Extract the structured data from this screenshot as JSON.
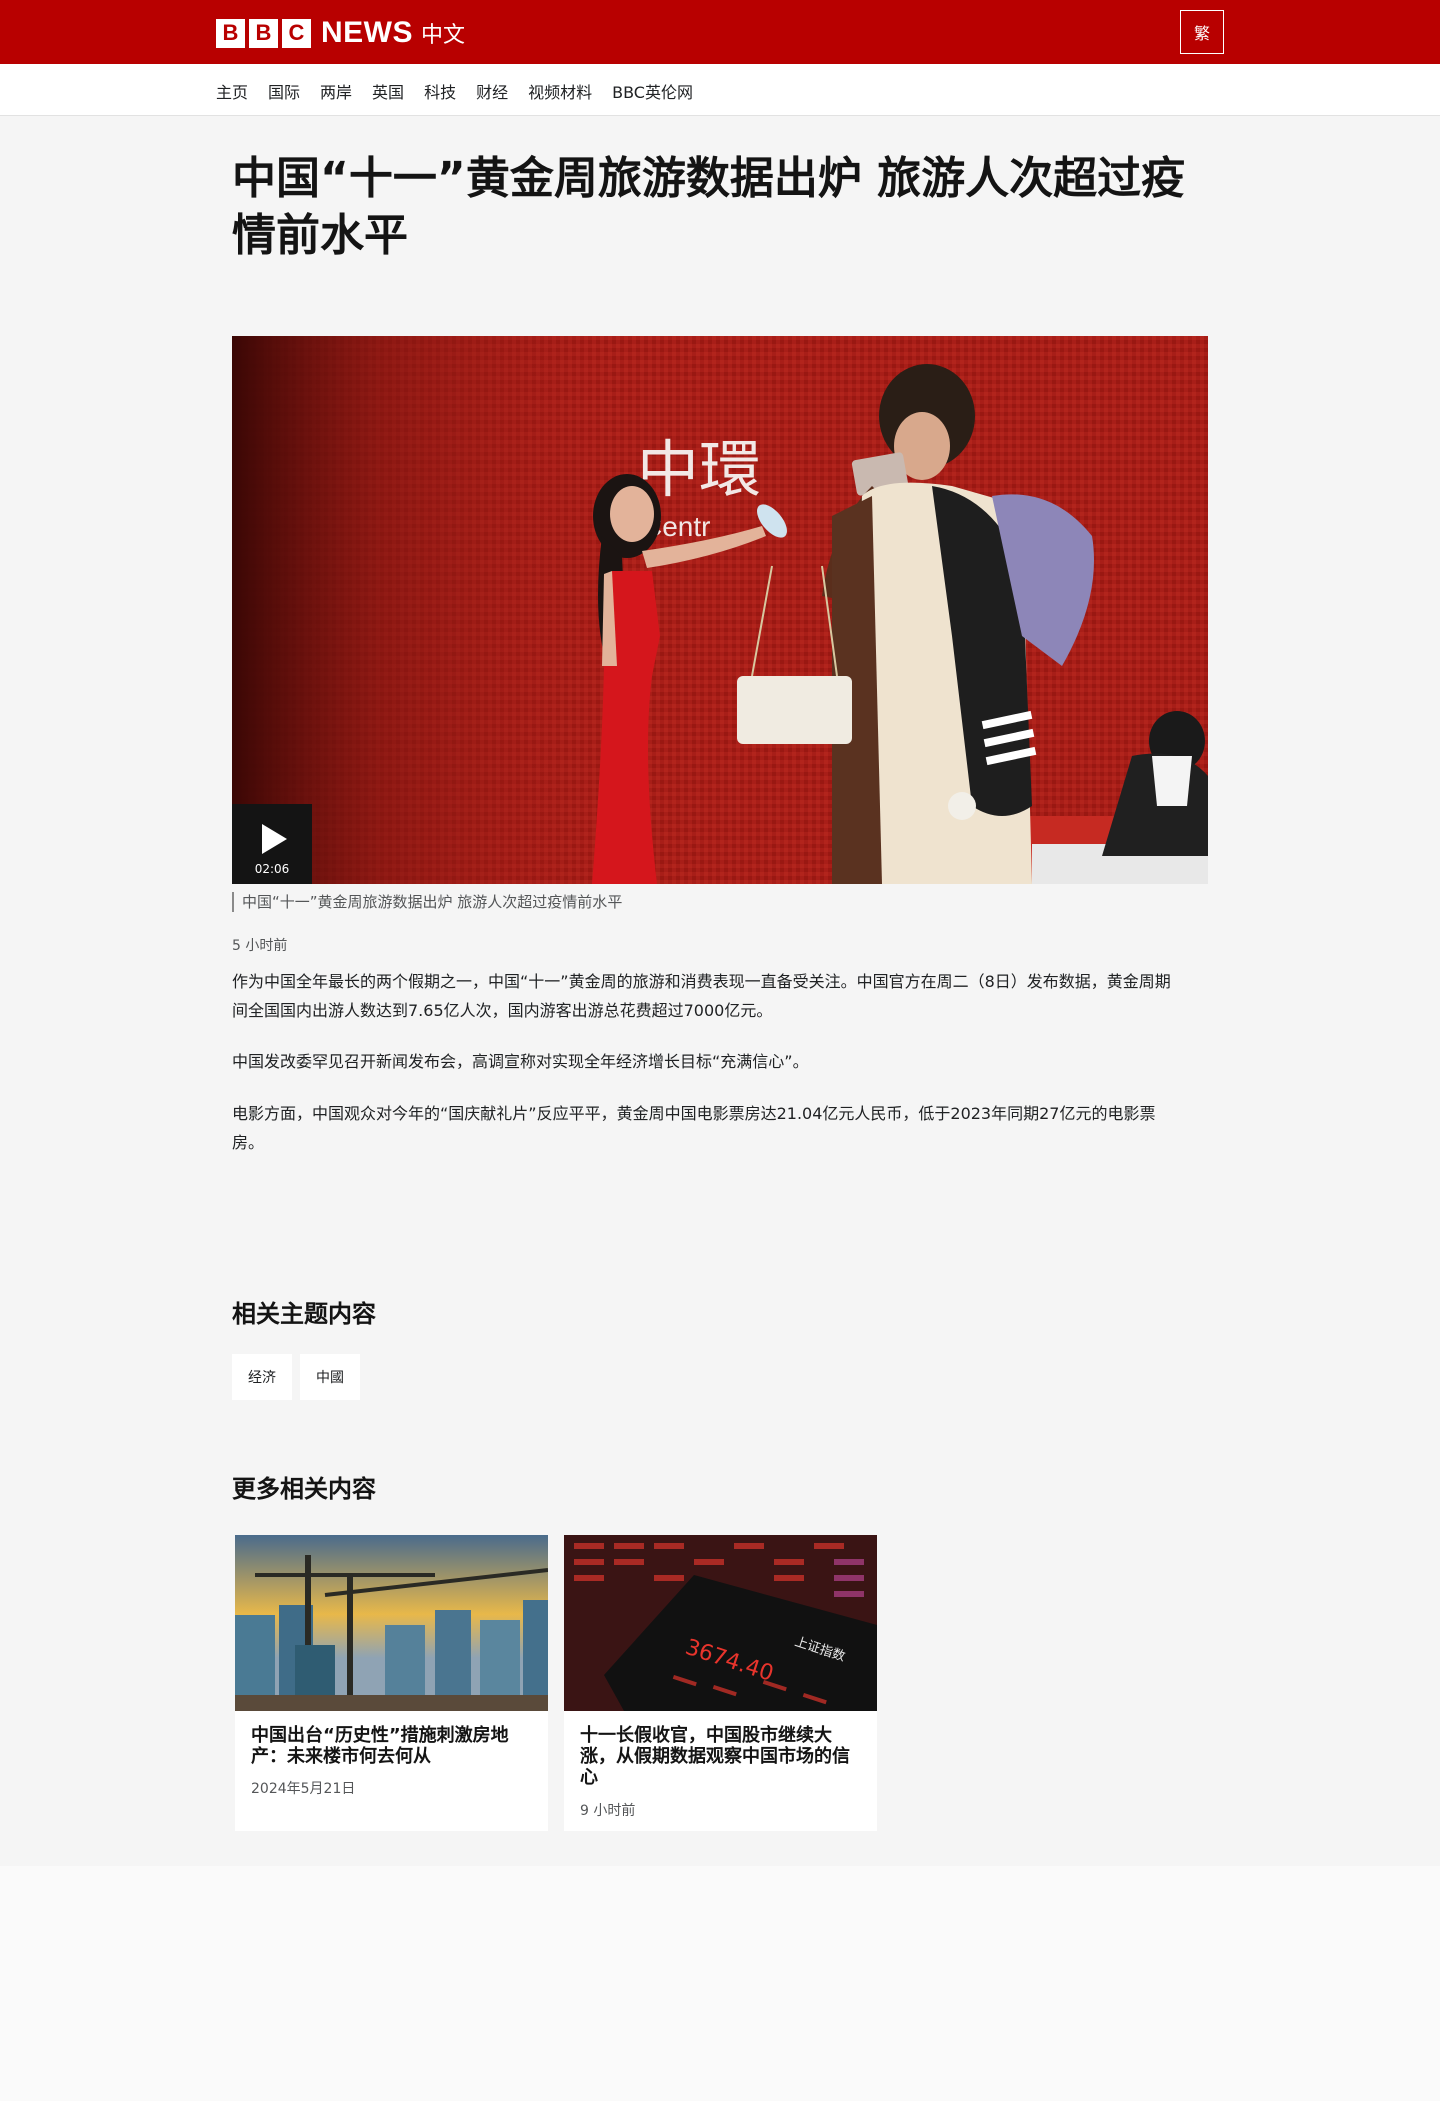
{
  "header": {
    "logo_letters": [
      "B",
      "B",
      "C"
    ],
    "logo_news": "NEWS",
    "logo_lang": "中文",
    "variant_toggle": "繁",
    "brand_color": "#b80000"
  },
  "nav": {
    "items": [
      "主页",
      "国际",
      "两岸",
      "英国",
      "科技",
      "财经",
      "视频材料",
      "BBC英伦网"
    ]
  },
  "article": {
    "headline": "中国“十一”黄金周旅游数据出炉 旅游人次超过疫情前水平",
    "video": {
      "duration": "02:06",
      "caption": "中国“十一”黄金周旅游数据出炉 旅游人次超过疫情前水平",
      "sign_text": "中環",
      "sign_text_en": "Centr"
    },
    "timestamp": "5 小时前",
    "paragraphs": [
      "作为中国全年最长的两个假期之一，中国“十一”黄金周的旅游和消费表现一直备受关注。中国官方在周二（8日）发布数据，黄金周期间全国国内出游人数达到7.65亿人次，国内游客出游总花费超过7000亿元。",
      "中国发改委罕见召开新闻发布会，高调宣称对实现全年经济增长目标“充满信心”。",
      "电影方面，中国观众对今年的“国庆献礼片”反应平平，黄金周中国电影票房达21.04亿元人民币，低于2023年同期27亿元的电影票房。"
    ]
  },
  "topics": {
    "title": "相关主题内容",
    "items": [
      "经济",
      "中國"
    ]
  },
  "related": {
    "title": "更多相关内容",
    "cards": [
      {
        "title": "中国出台“历史性”措施刺激房地产：未来楼市何去何从",
        "date": "2024年5月21日"
      },
      {
        "title": "十一长假收官，中国股市继续大涨，从假期数据观察中国市场的信心",
        "date": "9 小时前",
        "screen_index": "3674.40",
        "screen_label": "上证指数"
      }
    ]
  }
}
